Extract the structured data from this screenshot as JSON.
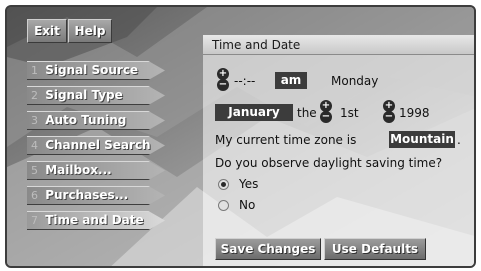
{
  "top_buttons": {
    "exit": "Exit",
    "help": "Help"
  },
  "menu": [
    {
      "num": "1",
      "label": "Signal Source"
    },
    {
      "num": "2",
      "label": "Signal Type"
    },
    {
      "num": "3",
      "label": "Auto Tuning"
    },
    {
      "num": "4",
      "label": "Channel Search"
    },
    {
      "num": "5",
      "label": "Mailbox..."
    },
    {
      "num": "6",
      "label": "Purchases..."
    },
    {
      "num": "7",
      "label": "Time and Date",
      "active": true
    }
  ],
  "panel": {
    "title": "Time and Date",
    "time_value": "--:--",
    "ampm": "am",
    "weekday": "Monday",
    "month": "January",
    "the_label": "the",
    "day": "1st",
    "year": "1998",
    "timezone_prompt": "My current time zone is",
    "timezone_value": "Mountain",
    "timezone_suffix": ".",
    "dst_question": "Do you observe daylight saving time?",
    "options": [
      "Yes",
      "No"
    ],
    "selected_option": "Yes",
    "save_label": "Save Changes",
    "defaults_label": "Use Defaults"
  }
}
